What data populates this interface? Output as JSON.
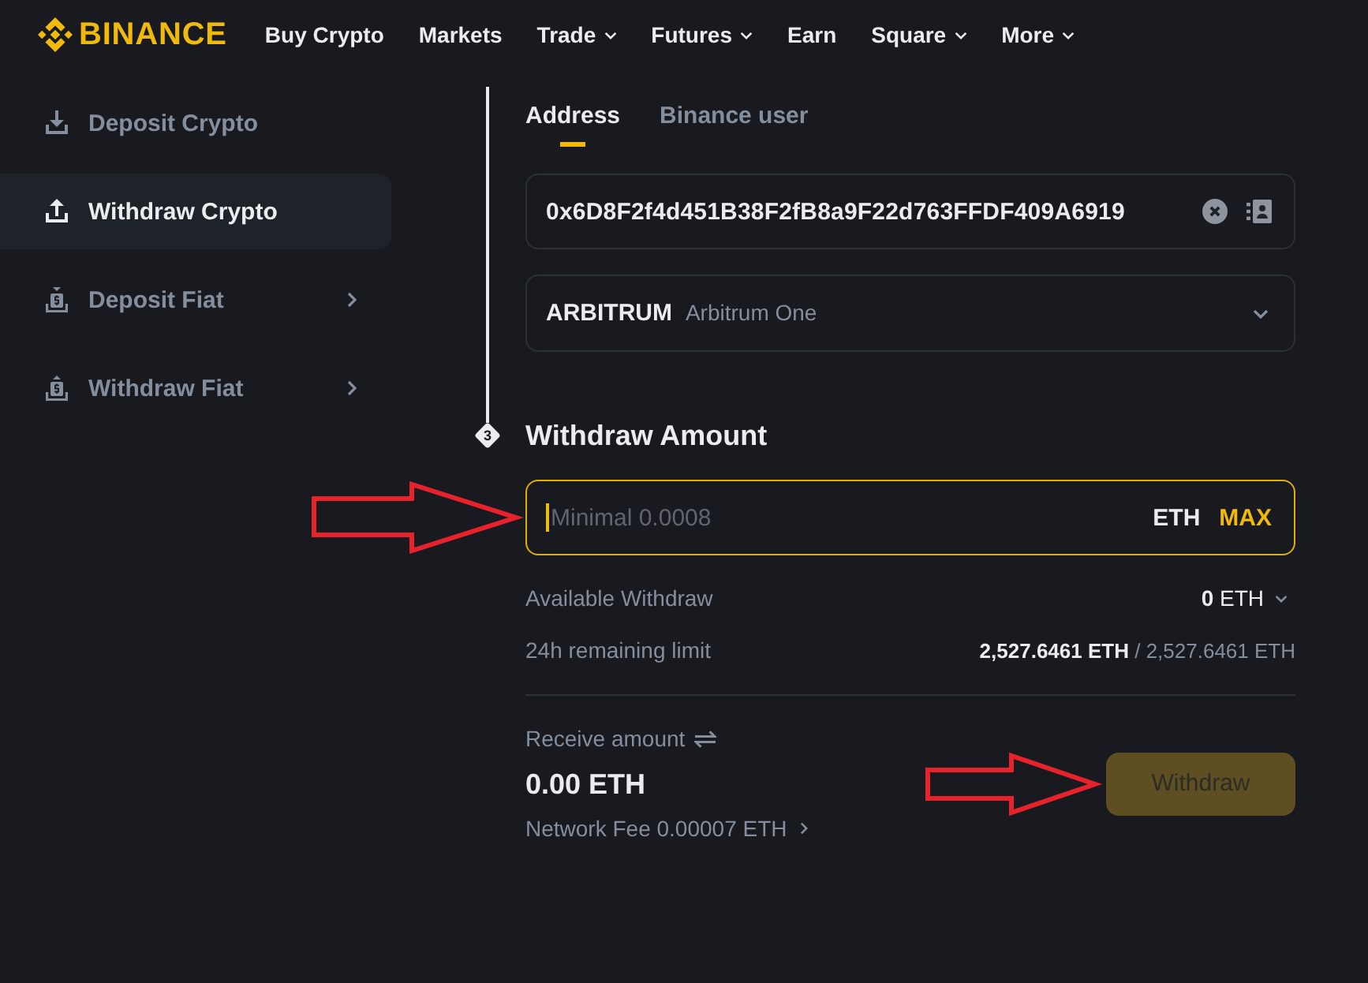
{
  "header": {
    "logo": "BINANCE",
    "nav": [
      {
        "label": "Buy Crypto",
        "dropdown": false
      },
      {
        "label": "Markets",
        "dropdown": false
      },
      {
        "label": "Trade",
        "dropdown": true
      },
      {
        "label": "Futures",
        "dropdown": true
      },
      {
        "label": "Earn",
        "dropdown": false
      },
      {
        "label": "Square",
        "dropdown": true
      },
      {
        "label": "More",
        "dropdown": true
      }
    ]
  },
  "sidebar": {
    "items": [
      {
        "label": "Deposit Crypto",
        "selected": false,
        "submenu": false
      },
      {
        "label": "Withdraw Crypto",
        "selected": true,
        "submenu": false
      },
      {
        "label": "Deposit Fiat",
        "selected": false,
        "submenu": true
      },
      {
        "label": "Withdraw Fiat",
        "selected": false,
        "submenu": true
      }
    ]
  },
  "recipient": {
    "tabs": [
      {
        "label": "Address",
        "selected": true
      },
      {
        "label": "Binance user",
        "selected": false
      }
    ],
    "address_field": {
      "value": "0x6D8F2f4d451B38F2fB8a9F22d763FFDF409A6919"
    },
    "network_select": {
      "code": "ARBITRUM",
      "name": "Arbitrum One"
    }
  },
  "withdraw_amount": {
    "step": "3",
    "title": "Withdraw Amount",
    "amount_field": {
      "placeholder": "Minimal 0.0008",
      "focused": true,
      "unit": "ETH",
      "max_label": "MAX"
    },
    "details": [
      {
        "label": "Available Withdraw",
        "value": "**0** ETH",
        "dropdown": true
      },
      {
        "label": "24h remaining limit",
        "value": "**2,527.6461 ETH** / 2,527.6461 ETH",
        "dropdown": false
      }
    ]
  },
  "receive": {
    "label": "Receive amount",
    "amount": "0.00 ETH",
    "network_fee": "Network Fee 0.00007 ETH"
  },
  "withdraw_button": {
    "label": "Withdraw",
    "disabled": true
  }
}
